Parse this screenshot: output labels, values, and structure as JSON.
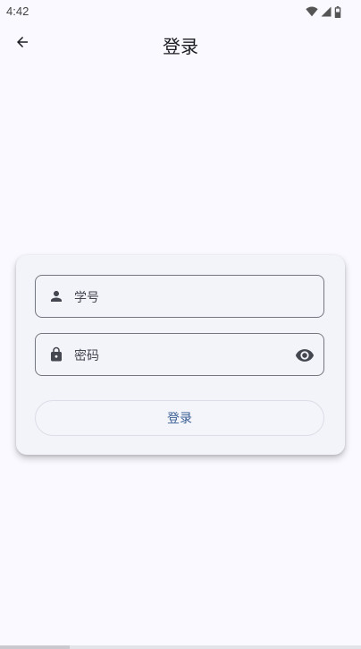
{
  "status_bar": {
    "time": "4:42",
    "icons": [
      "wifi-icon",
      "signal-icon",
      "battery-icon"
    ]
  },
  "app_bar": {
    "back_icon": "arrow-back-icon",
    "title": "登录"
  },
  "form": {
    "username": {
      "icon": "person-icon",
      "placeholder": "学号",
      "value": ""
    },
    "password": {
      "icon": "lock-icon",
      "placeholder": "密码",
      "value": "",
      "toggle_icon": "eye-icon"
    },
    "submit_label": "登录"
  },
  "colors": {
    "background": "#f9f9ff",
    "card": "#f3f3fa",
    "outline": "#74777f",
    "primary_text": "#3a5f94",
    "icon": "#44474f"
  }
}
